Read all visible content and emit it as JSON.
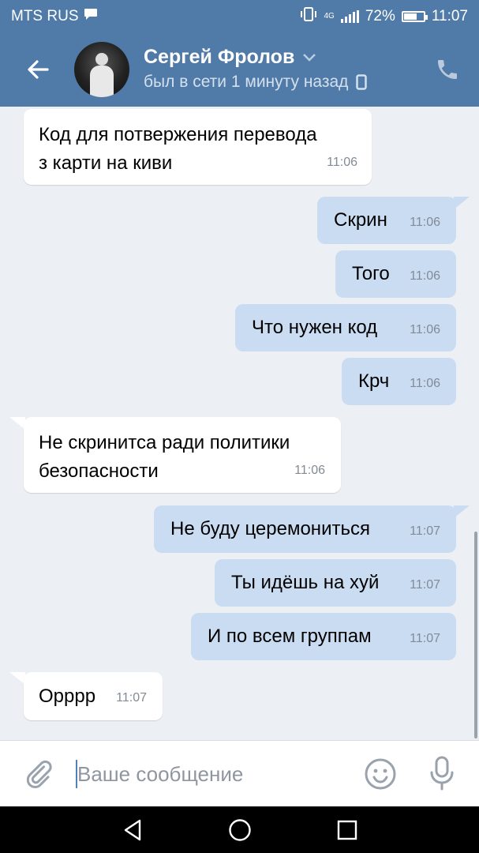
{
  "statusbar": {
    "carrier": "MTS RUS",
    "network": "4G",
    "battery": "72%",
    "battery_level": 0.72,
    "time": "11:07"
  },
  "header": {
    "name": "Сергей Фролов",
    "status": "был в сети 1 минуту назад"
  },
  "messages": [
    {
      "dir": "in",
      "text_lines": [
        "Код для потвержения перевода",
        "з карти на киви"
      ],
      "time": "11:06"
    },
    {
      "dir": "out",
      "text": "Скрин",
      "time": "11:06"
    },
    {
      "dir": "out",
      "text": "Того",
      "time": "11:06"
    },
    {
      "dir": "out",
      "text": "Что нужен код",
      "time": "11:06"
    },
    {
      "dir": "out",
      "text": "Крч",
      "time": "11:06"
    },
    {
      "dir": "in",
      "text_lines": [
        "Не скринитса ради политики",
        "безопасности"
      ],
      "time": "11:06"
    },
    {
      "dir": "out",
      "text": "Не буду церемониться",
      "time": "11:07"
    },
    {
      "dir": "out",
      "text": "Ты идёшь на хуй",
      "time": "11:07"
    },
    {
      "dir": "out",
      "text": "И по всем группам",
      "time": "11:07"
    },
    {
      "dir": "in",
      "text": "Орррр",
      "time": "11:07"
    }
  ],
  "input": {
    "placeholder": "Ваше сообщение"
  },
  "icons": {
    "back": "arrow-left-icon",
    "phone": "phone-icon",
    "attach": "paperclip-icon",
    "emoji": "smile-icon",
    "voice": "microphone-icon"
  },
  "colors": {
    "header": "#507aa8",
    "outgoing_bubble": "#cadcf2",
    "incoming_bubble": "#ffffff",
    "background": "#eceff3"
  }
}
